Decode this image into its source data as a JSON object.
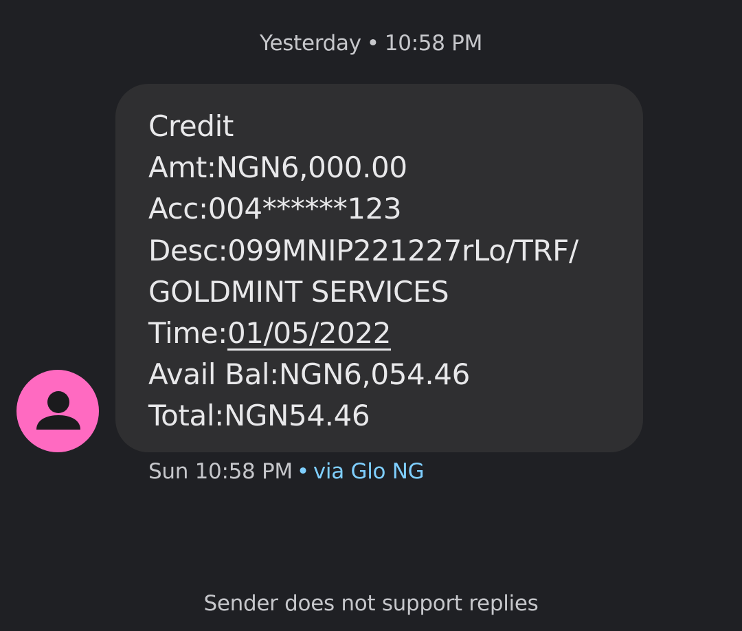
{
  "conversation": {
    "date_header": {
      "day": "Yesterday",
      "separator": "•",
      "time": "10:58 PM"
    },
    "message": {
      "lines": [
        "Credit",
        "Amt:NGN6,000.00",
        "Acc:004******123",
        "Desc:099MNIP221227rLo/TRF/",
        "GOLDMINT SERVICES"
      ],
      "time_prefix": "Time:",
      "time_link": "01/05/2022",
      "lines_after": [
        "Avail Bal:NGN6,054.46",
        "Total:NGN54.46"
      ],
      "meta": {
        "timestamp": "Sun 10:58 PM",
        "separator": "•",
        "carrier": "via Glo NG"
      }
    },
    "footer_note": "Sender does not support replies"
  },
  "colors": {
    "background": "#1f2024",
    "bubble": "#2f2f31",
    "avatar": "#ff6ac1",
    "carrier_accent": "#7fcfff",
    "text_primary": "#e8e8ea",
    "text_secondary": "#c6c7cb"
  },
  "icons": {
    "avatar": "person-icon"
  }
}
